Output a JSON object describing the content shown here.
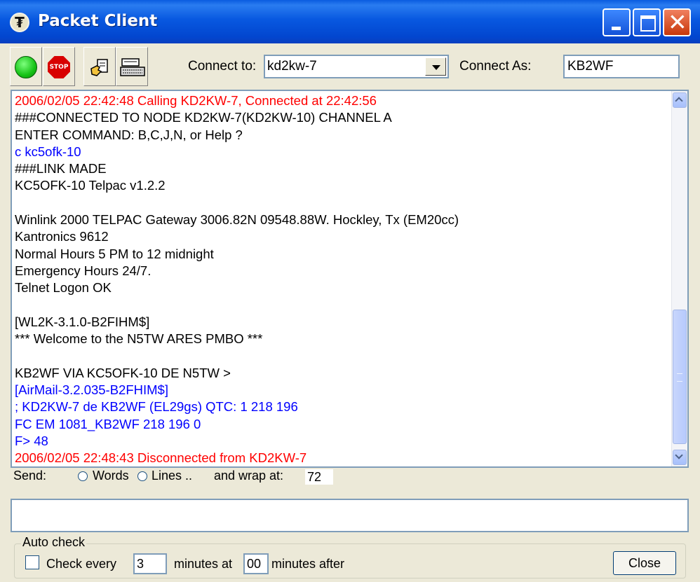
{
  "window": {
    "title": "Packet Client",
    "icon": "packet-client-app-icon",
    "controls": {
      "minimize": "minimize-icon",
      "maximize": "maximize-icon",
      "close": "close-icon"
    }
  },
  "toolbar": {
    "buttons": [
      {
        "name": "connect-button",
        "icon": "green-circle-icon"
      },
      {
        "name": "stop-button",
        "icon": "stop-sign-icon",
        "text": "STOP"
      },
      {
        "name": "send-file-button",
        "icon": "hand-document-icon"
      },
      {
        "name": "keyboard-button",
        "icon": "keyboard-icon"
      }
    ],
    "connect_to_label": "Connect to:",
    "connect_to_value": "kd2kw-7",
    "connect_as_label": "Connect As:",
    "connect_as_value": "KB2WF"
  },
  "terminal": {
    "lines": [
      {
        "text": "2006/02/05 22:42:48 Calling KD2KW-7, Connected at 22:42:56",
        "color": "red"
      },
      {
        "text": "###CONNECTED TO NODE KD2KW-7(KD2KW-10) CHANNEL A",
        "color": "black"
      },
      {
        "text": "ENTER COMMAND: B,C,J,N, or Help ?",
        "color": "black"
      },
      {
        "text": "c kc5ofk-10",
        "color": "blue"
      },
      {
        "text": "###LINK MADE",
        "color": "black"
      },
      {
        "text": "KC5OFK-10 Telpac v1.2.2",
        "color": "black"
      },
      {
        "text": "",
        "color": "black"
      },
      {
        "text": "Winlink 2000 TELPAC Gateway 3006.82N 09548.88W. Hockley, Tx (EM20cc)",
        "color": "black"
      },
      {
        "text": "Kantronics 9612",
        "color": "black"
      },
      {
        "text": "Normal Hours 5 PM to 12 midnight",
        "color": "black"
      },
      {
        "text": "Emergency Hours 24/7.",
        "color": "black"
      },
      {
        "text": "Telnet Logon OK",
        "color": "black"
      },
      {
        "text": "",
        "color": "black"
      },
      {
        "text": "[WL2K-3.1.0-B2FIHM$]",
        "color": "black"
      },
      {
        "text": "*** Welcome to the N5TW ARES PMBO ***",
        "color": "black"
      },
      {
        "text": "",
        "color": "black"
      },
      {
        "text": "KB2WF VIA KC5OFK-10 DE N5TW >",
        "color": "black"
      },
      {
        "text": "[AirMail-3.2.035-B2FHIM$]",
        "color": "blue"
      },
      {
        "text": "; KD2KW-7 de KB2WF (EL29gs) QTC: 1 218 196",
        "color": "blue"
      },
      {
        "text": "FC EM 1081_KB2WF 218 196 0",
        "color": "blue"
      },
      {
        "text": "F> 48",
        "color": "blue"
      },
      {
        "text": "2006/02/05 22:48:43 Disconnected from KD2KW-7",
        "color": "red"
      }
    ],
    "scroll_position": 0.85
  },
  "send": {
    "label": "Send:",
    "words_label": "Words",
    "lines_label": "Lines .. ",
    "wrap_label": "and wrap at:",
    "wrap_value": "72",
    "input_value": ""
  },
  "autocheck": {
    "legend": "Auto check",
    "check_label": "Check every",
    "every_value": "3",
    "minutes_at_label": "minutes at",
    "at_value": "00",
    "minutes_after_label": "minutes after",
    "checked": false
  },
  "close_button": "Close",
  "colors": {
    "titlebar": "#0846d8",
    "received": "#000000",
    "sent": "#0000ff",
    "status": "#ff0000",
    "face": "#ece9d8"
  }
}
